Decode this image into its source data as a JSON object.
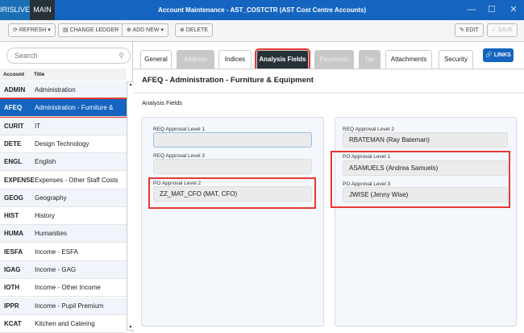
{
  "window": {
    "tabs": [
      "IRISLIVE",
      "MAIN"
    ],
    "title": "Account Maintenance - AST_COSTCTR (AST Cost Centre Accounts)",
    "controls": [
      "—",
      "☐",
      "✕"
    ]
  },
  "toolbar": {
    "refresh": "REFRESH",
    "change_ledger": "CHANGE LEDGER",
    "add_new": "ADD NEW",
    "delete": "DELETE",
    "edit": "EDIT",
    "save": "SAVE"
  },
  "search": {
    "placeholder": "Search"
  },
  "list": {
    "headers": [
      "Account",
      "Title"
    ],
    "rows": [
      {
        "code": "ADMIN",
        "title": "Administration"
      },
      {
        "code": "AFEQ",
        "title": "Administration - Furniture &"
      },
      {
        "code": "CURIT",
        "title": "IT"
      },
      {
        "code": "DETE",
        "title": "Design Technology"
      },
      {
        "code": "ENGL",
        "title": "English"
      },
      {
        "code": "EXPENSE",
        "title": "Expenses - Other Staff Costs"
      },
      {
        "code": "GEOG",
        "title": "Geography"
      },
      {
        "code": "HIST",
        "title": "History"
      },
      {
        "code": "HUMA",
        "title": "Humanities"
      },
      {
        "code": "IESFA",
        "title": "Income - ESFA"
      },
      {
        "code": "IGAG",
        "title": "Income - GAG"
      },
      {
        "code": "IOTH",
        "title": "Income - Other Income"
      },
      {
        "code": "IPPR",
        "title": "Income - Pupil Premium"
      },
      {
        "code": "KCAT",
        "title": "Kitchen and Catering"
      }
    ]
  },
  "tabs": [
    "General",
    "Address",
    "Indices",
    "Analysis Fields",
    "Payments",
    "Tax",
    "Attachments",
    "Security"
  ],
  "links": "LINKS",
  "detail": {
    "heading": "AFEQ - Administration - Furniture & Equipment",
    "section": "Analysis Fields",
    "left": [
      {
        "label": "REQ Approval Level 1",
        "value": ""
      },
      {
        "label": "REQ Approval Level 3",
        "value": ""
      },
      {
        "label": "PO Approval Level 2",
        "value": "ZZ_MAT_CFO (MAT, CFO)"
      }
    ],
    "right": [
      {
        "label": "REQ Approval Level 2",
        "value": "RBATEMAN (Ray Bateman)"
      },
      {
        "label": "PO Approval Level 1",
        "value": "ASAMUELS (Andrea Samuels)"
      },
      {
        "label": "PO Approval Level 3",
        "value": "JWISE (Jenny Wise)"
      }
    ]
  }
}
